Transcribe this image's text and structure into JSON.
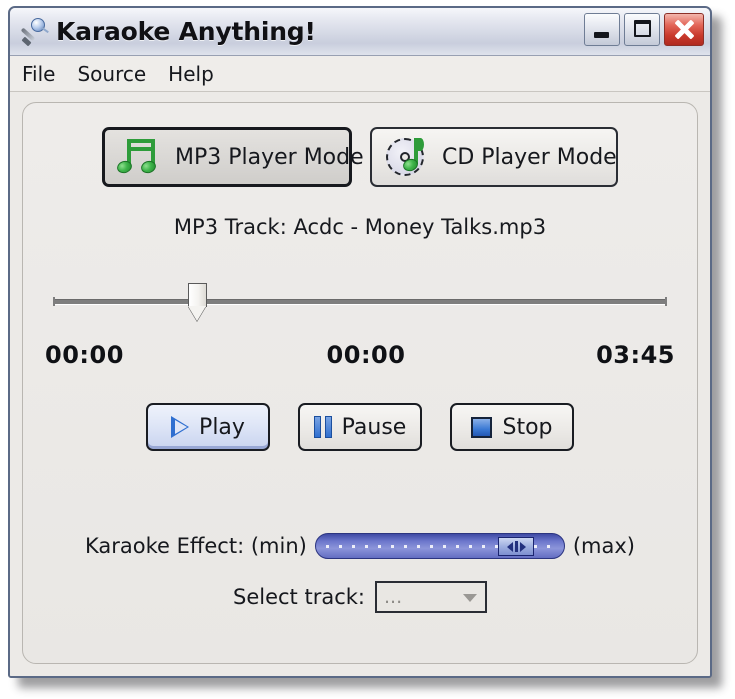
{
  "window": {
    "title": "Karaoke Anything!",
    "icon": "microphone-icon",
    "controls": {
      "minimize": "–",
      "maximize": "□",
      "close": "✕"
    }
  },
  "menubar": {
    "items": [
      {
        "label": "File"
      },
      {
        "label": "Source"
      },
      {
        "label": "Help"
      }
    ]
  },
  "modes": {
    "mp3": {
      "label": "MP3 Player Mode",
      "icon": "music-note-icon",
      "selected": true
    },
    "cd": {
      "label": "CD Player Mode",
      "icon": "cd-disc-note-icon",
      "selected": false
    }
  },
  "track": {
    "label": "MP3 Track: Acdc  - Money Talks.mp3"
  },
  "progress": {
    "position_percent": 23.5,
    "start_time": "00:00",
    "current_time": "00:00",
    "total_time": "03:45"
  },
  "transport": {
    "play": {
      "label": "Play",
      "icon": "play-triangle-icon",
      "active": true
    },
    "pause": {
      "label": "Pause",
      "icon": "pause-bars-icon",
      "active": false
    },
    "stop": {
      "label": "Stop",
      "icon": "stop-square-icon",
      "active": false
    }
  },
  "effect": {
    "label": "Karaoke Effect: (min)",
    "max_label": "(max)",
    "value_percent": 88
  },
  "select_track": {
    "label": "Select track:",
    "value": "...",
    "placeholder": "...",
    "options": [
      "..."
    ]
  },
  "colors": {
    "accent_blue": "#2f6fd0",
    "note_green": "#2e9c3a",
    "slider_blue": "#6c77cc",
    "close_red": "#c8392c",
    "window_bg": "#eceae7"
  }
}
